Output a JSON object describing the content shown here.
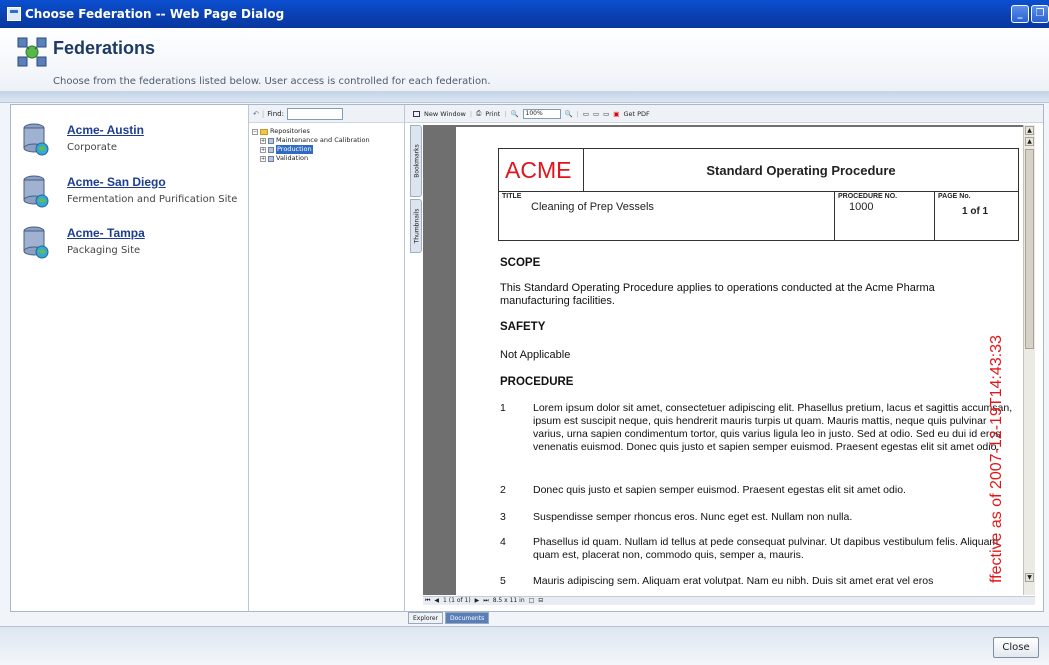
{
  "window": {
    "title": "Choose Federation -- Web Page Dialog"
  },
  "header": {
    "title": "Federations",
    "subtitle": "Choose from the federations listed below. User access is controlled for each federation."
  },
  "federations": [
    {
      "name": "Acme- Austin",
      "description": "Corporate"
    },
    {
      "name": "Acme- San Diego",
      "description": "Fermentation and Purification Site"
    },
    {
      "name": "Acme- Tampa",
      "description": "Packaging Site"
    }
  ],
  "tree": {
    "find_label": "Find:",
    "root": "Repositories",
    "items": [
      "Maintenance and Calibration",
      "Production",
      "Validation"
    ],
    "selected": "Production"
  },
  "viewer": {
    "toolbar": {
      "new_window": "New Window",
      "print": "Print",
      "zoom": "100%",
      "get_pdf": "Get PDF"
    },
    "side_tabs": [
      "Bookmarks",
      "Thumbnails"
    ],
    "nav": {
      "page": "1 (1 of 1)",
      "size": "8.5 x 11 in"
    },
    "bottom_tabs": [
      "Explorer",
      "Documents"
    ],
    "active_bottom_tab": "Documents"
  },
  "sop": {
    "company": "ACME",
    "doc_title": "Standard Operating Procedure",
    "title_label": "TITLE",
    "title_value": "Cleaning of Prep Vessels",
    "procno_label": "PROCEDURE NO.",
    "procno_value": "1000",
    "page_label": "PAGE No.",
    "page_value": "1 of 1",
    "scope_heading": "SCOPE",
    "scope_text_1": "This Standard Operating Procedure applies to operations conducted at the Acme Pharma",
    "scope_text_2": "manufacturing facilities.",
    "safety_heading": "SAFETY",
    "safety_text": "Not Applicable",
    "procedure_heading": "PROCEDURE",
    "steps": [
      {
        "num": "1",
        "text": "Lorem ipsum dolor sit amet, consectetuer adipiscing elit. Phasellus pretium, lacus et sagittis accumsan, ipsum est suscipit neque, quis hendrerit mauris turpis ut quam. Mauris mattis, neque quis pulvinar varius, urna sapien condimentum tortor, quis varius ligula leo in justo. Sed at odio. Sed eu dui id eros venenatis euismod. Donec quis justo et sapien semper euismod. Praesent egestas elit sit amet odio."
      },
      {
        "num": "2",
        "text": "Donec quis justo et sapien semper euismod. Praesent egestas elit sit amet odio."
      },
      {
        "num": "3",
        "text": "Suspendisse semper rhoncus eros. Nunc eget est. Nullam non nulla."
      },
      {
        "num": "4",
        "text": "Phasellus id quam. Nullam id tellus at pede consequat pulvinar. Ut dapibus vestibulum felis. Aliquam quam est, placerat non, commodo quis, semper a, mauris."
      },
      {
        "num": "5",
        "text": "Mauris adipiscing sem. Aliquam erat volutpat. Nam eu nibh. Duis sit amet erat vel eros"
      }
    ],
    "watermark": "ffective as of 2007-12-19T14:43:33"
  },
  "footer": {
    "close_label": "Close"
  }
}
